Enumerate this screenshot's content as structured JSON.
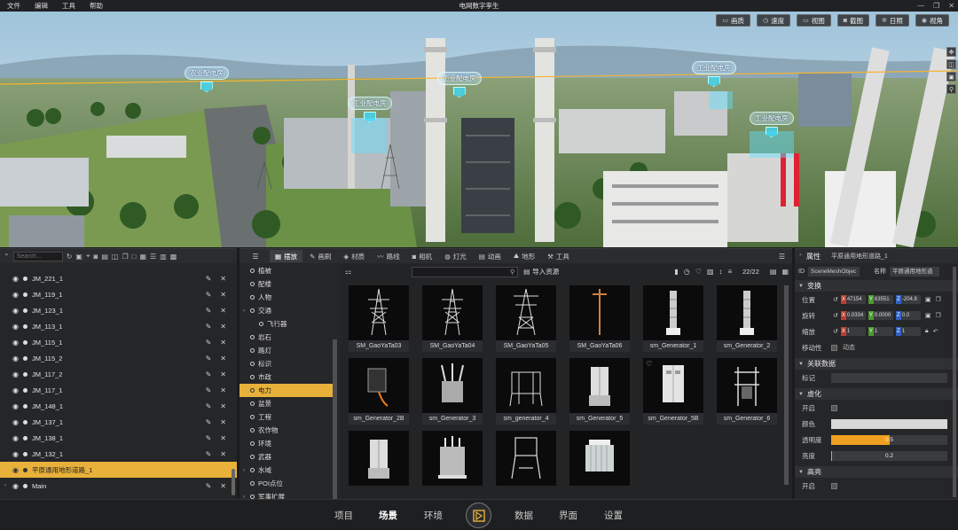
{
  "window": {
    "title": "电网数字孪生",
    "controls": [
      "—",
      "❐",
      "✕"
    ]
  },
  "menu": [
    "文件",
    "编辑",
    "工具",
    "帮助"
  ],
  "viewport": {
    "tools": [
      {
        "icon": "monitor-icon",
        "glyph": "▭",
        "label": "画质"
      },
      {
        "icon": "speed-icon",
        "glyph": "◷",
        "label": "速度"
      },
      {
        "icon": "view-icon",
        "glyph": "▭",
        "label": "视图"
      },
      {
        "icon": "camera-icon",
        "glyph": "◙",
        "label": "截图"
      },
      {
        "icon": "sun-icon",
        "glyph": "✲",
        "label": "日照"
      },
      {
        "icon": "eye-icon",
        "glyph": "◉",
        "label": "视角"
      }
    ],
    "side": [
      "✥",
      "◫",
      "▣",
      "⚲"
    ],
    "pois": [
      {
        "label": "农业配电房"
      },
      {
        "label": "工业配电房"
      },
      {
        "label": "工业配电房"
      },
      {
        "label": "工业配电房"
      },
      {
        "label": "工业配电房"
      }
    ]
  },
  "outliner": {
    "search_placeholder": "Search...",
    "items": [
      {
        "name": "JM_221_1"
      },
      {
        "name": "JM_119_1"
      },
      {
        "name": "JM_123_1"
      },
      {
        "name": "JM_113_1"
      },
      {
        "name": "JM_115_1"
      },
      {
        "name": "JM_115_2"
      },
      {
        "name": "JM_117_2"
      },
      {
        "name": "JM_117_1"
      },
      {
        "name": "JM_148_1"
      },
      {
        "name": "JM_137_1"
      },
      {
        "name": "JM_138_1"
      },
      {
        "name": "JM_132_1"
      }
    ],
    "selected": "平原通用地形道路_1",
    "root": "Main"
  },
  "assets_tabs": [
    {
      "icon": "▦",
      "label": "摆放",
      "active": true
    },
    {
      "icon": "✎",
      "label": "画刷"
    },
    {
      "icon": "◈",
      "label": "材质"
    },
    {
      "icon": "〰",
      "label": "路线"
    },
    {
      "icon": "◙",
      "label": "相机"
    },
    {
      "icon": "◍",
      "label": "灯光"
    },
    {
      "icon": "▤",
      "label": "动画"
    },
    {
      "icon": "⛰",
      "label": "地形"
    },
    {
      "icon": "⚒",
      "label": "工具"
    }
  ],
  "categories": [
    {
      "label": "植被"
    },
    {
      "label": "配楼"
    },
    {
      "label": "人物"
    },
    {
      "label": "交通",
      "expand": true
    },
    {
      "label": "飞行器",
      "sub": true
    },
    {
      "label": "岩石"
    },
    {
      "label": "路灯"
    },
    {
      "label": "标识"
    },
    {
      "label": "市政"
    },
    {
      "label": "电力",
      "selected": true
    },
    {
      "label": "盆景"
    },
    {
      "label": "工程"
    },
    {
      "label": "农作物"
    },
    {
      "label": "环境"
    },
    {
      "label": "武器"
    },
    {
      "label": "水域",
      "expand": true
    },
    {
      "label": "POI点位"
    },
    {
      "label": "军事扩展",
      "expand": true
    },
    {
      "label": "军事"
    }
  ],
  "assets": {
    "import_label": "导入资源",
    "count": "22/22",
    "items": [
      {
        "name": "SM_GaoYaTa03",
        "kind": "tower"
      },
      {
        "name": "SM_GaoYaTa04",
        "kind": "tower"
      },
      {
        "name": "SM_GaoYaTa05",
        "kind": "tower2"
      },
      {
        "name": "SM_GaoYaTa06",
        "kind": "pole"
      },
      {
        "name": "sm_Generator_1",
        "kind": "column"
      },
      {
        "name": "sm_Generator_2",
        "kind": "column"
      },
      {
        "name": "sm_Generator_2B",
        "kind": "box"
      },
      {
        "name": "sm_Generator_3",
        "kind": "transformer"
      },
      {
        "name": "sm_generator_4",
        "kind": "frame"
      },
      {
        "name": "sm_Generator_5",
        "kind": "cabinet"
      },
      {
        "name": "sm_Generator_5B",
        "kind": "cabinet2"
      },
      {
        "name": "sm_Generator_6",
        "kind": "frame2"
      },
      {
        "name": "",
        "kind": "cabinet"
      },
      {
        "name": "",
        "kind": "transformer2"
      },
      {
        "name": "",
        "kind": "frame3"
      },
      {
        "name": "",
        "kind": "tank"
      }
    ]
  },
  "properties": {
    "title": "属性",
    "object_name": "平原通用地形道路_1",
    "id_label": "ID",
    "id_value": "SceneMeshObjec",
    "name_label": "名称",
    "name_value": "平原通用地形道",
    "sections": {
      "transform": "变换",
      "related": "关联数据",
      "blur": "虚化",
      "highlight": "高亮"
    },
    "position": {
      "label": "位置",
      "x": "47154",
      "y": "63551",
      "z": "-204.8"
    },
    "rotation": {
      "label": "旋转",
      "x": "0.0334",
      "y": "0.0000",
      "z": "0.0"
    },
    "scale": {
      "label": "缩放",
      "x": "1",
      "y": "1",
      "z": "1"
    },
    "movable_label": "移动性",
    "dynamic_label": "动态",
    "tag_label": "标记",
    "enable_label": "开启",
    "color_label": "颜色",
    "opacity_label": "透明度",
    "opacity_value": "0.5",
    "brightness_label": "亮度",
    "brightness_value": "0.2",
    "highlight_enable_label": "开启"
  },
  "bottom_nav": {
    "left": [
      {
        "label": "项目"
      },
      {
        "label": "场景",
        "active": true
      },
      {
        "label": "环境"
      }
    ],
    "right": [
      {
        "label": "数据"
      },
      {
        "label": "界面"
      },
      {
        "label": "设置"
      }
    ]
  },
  "colors": {
    "accent": "#e8b13a",
    "slider": "#f0a020",
    "x": "#c23b2f",
    "y": "#4b9a2e",
    "z": "#2f62c2"
  }
}
